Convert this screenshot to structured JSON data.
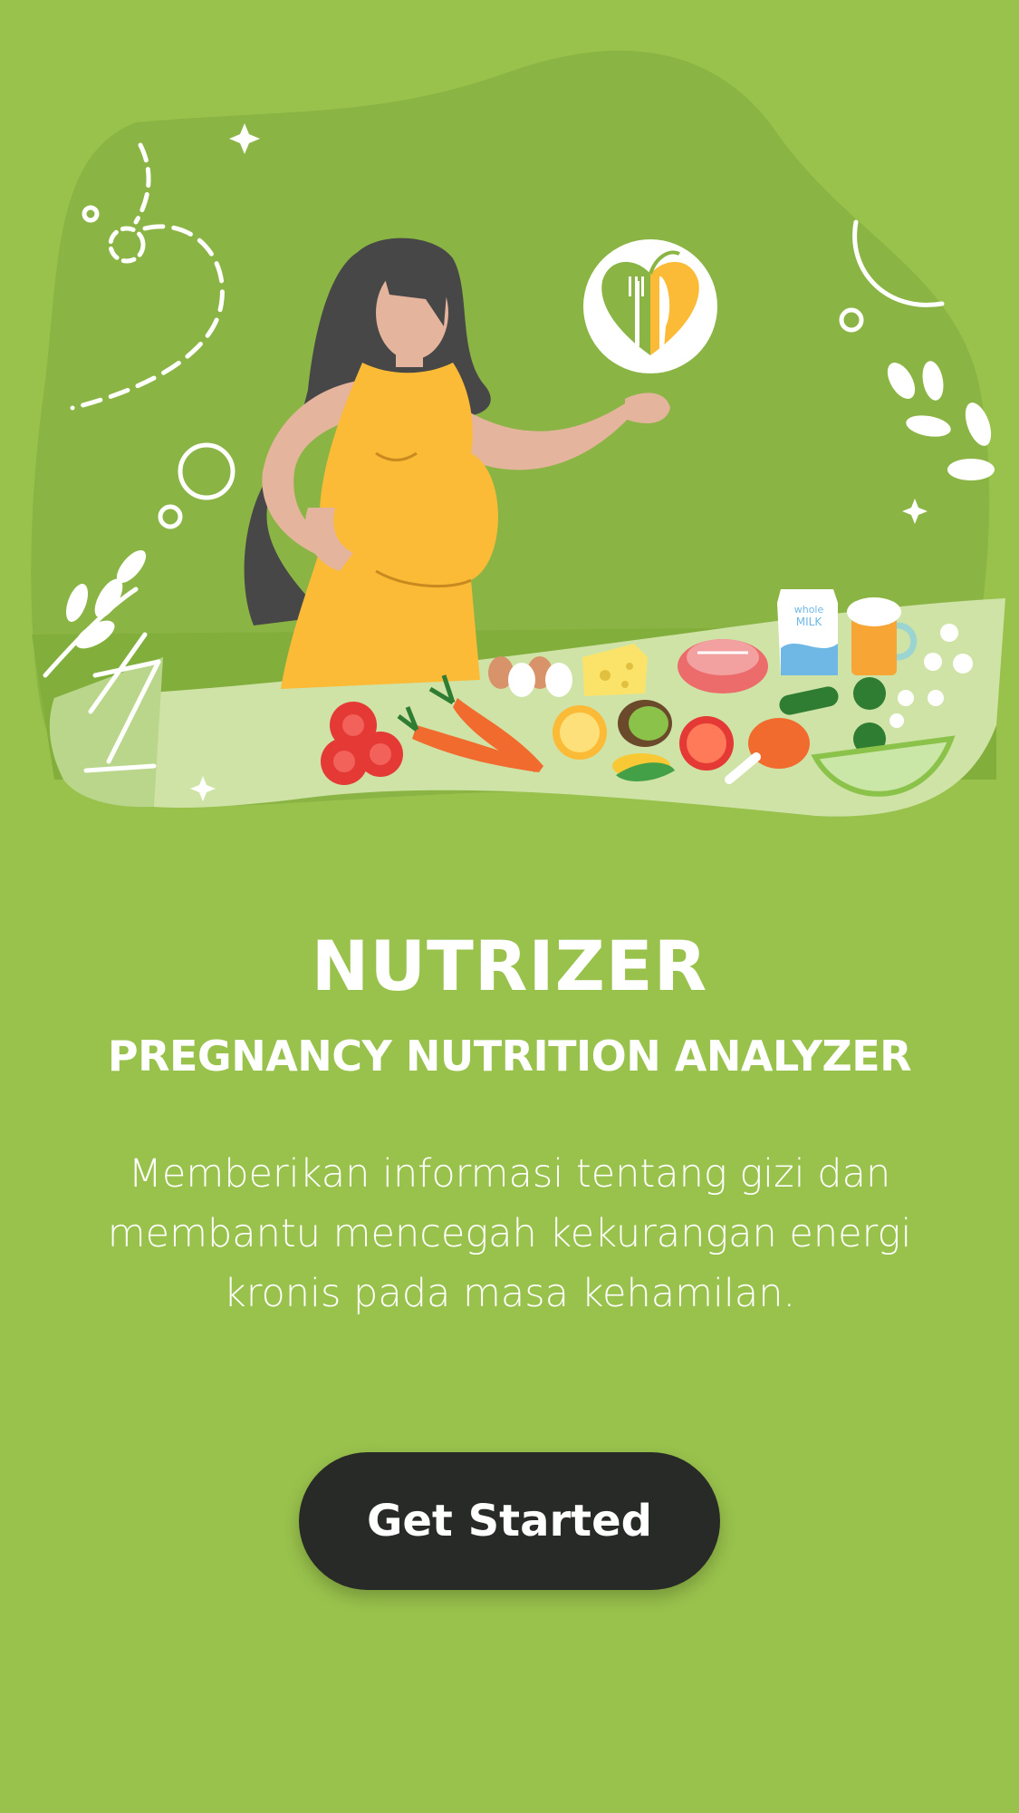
{
  "app": {
    "title": "NUTRIZER",
    "subtitle": "PREGNANCY NUTRITION ANALYZER",
    "description": "Memberikan informasi tentang gizi dan membantu mencegah kekurangan energi kronis pada masa kehamilan."
  },
  "illustration": {
    "milk_carton_label_line1": "whole",
    "milk_carton_label_line2": "MILK"
  },
  "cta": {
    "label": "Get Started"
  },
  "colors": {
    "background": "#99c24c",
    "blob": "#8ab443",
    "table": "#cfe3a7",
    "button": "#272a26",
    "dress": "#fbbb36"
  }
}
